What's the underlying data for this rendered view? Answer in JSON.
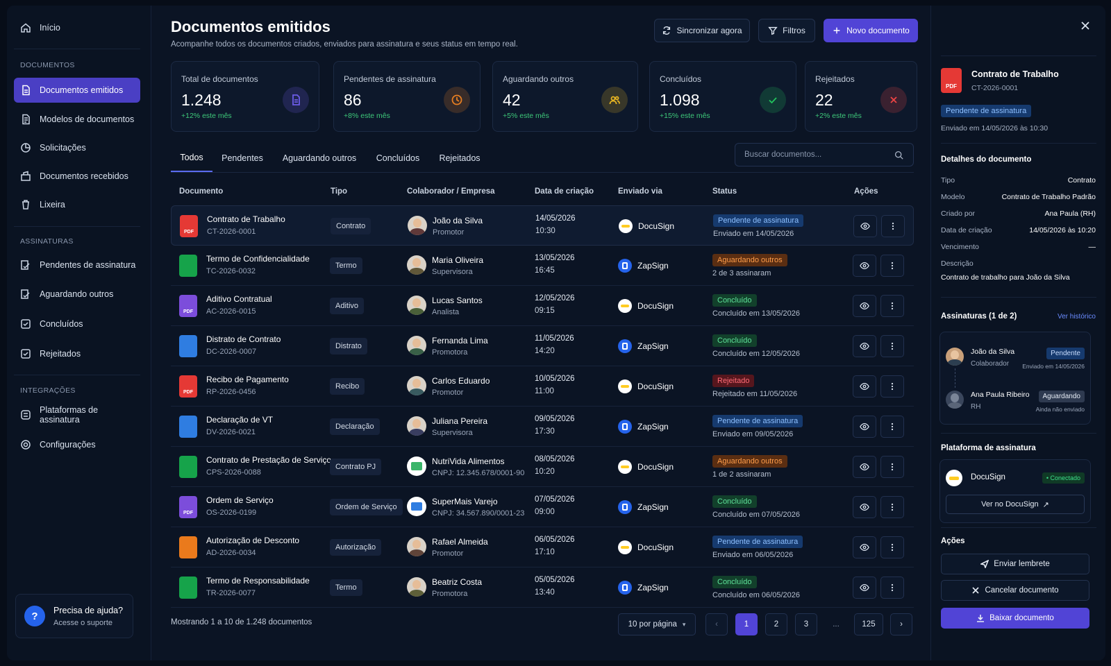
{
  "sidebar": {
    "home": "Início",
    "section_docs": "DOCUMENTOS",
    "docs_items": [
      "Documentos emitidos",
      "Modelos de documentos",
      "Solicitações",
      "Documentos recebidos",
      "Lixeira"
    ],
    "section_sign": "ASSINATURAS",
    "sign_items": [
      "Pendentes de assinatura",
      "Aguardando outros",
      "Concluídos",
      "Rejeitados"
    ],
    "section_int": "INTEGRAÇÕES",
    "int_items": [
      "Plataformas de assinatura",
      "Configurações"
    ],
    "help_title": "Precisa de ajuda?",
    "help_sub": "Acesse o suporte"
  },
  "header": {
    "title": "Documentos emitidos",
    "subtitle": "Acompanhe todos os documentos criados, enviados para assinatura e seus status em tempo real.",
    "sync": "Sincronizar agora",
    "filters": "Filtros",
    "new_doc": "Novo documento"
  },
  "stats": [
    {
      "label": "Total de documentos",
      "value": "1.248",
      "change": "+12% este mês",
      "color": "#6c5ce7",
      "icon": "document-icon"
    },
    {
      "label": "Pendentes de assinatura",
      "value": "86",
      "change": "+8% este mês",
      "color": "#e67e22",
      "icon": "clock-icon"
    },
    {
      "label": "Aguardando outros",
      "value": "42",
      "change": "+5% este mês",
      "color": "#e6b422",
      "icon": "users-icon"
    },
    {
      "label": "Concluídos",
      "value": "1.098",
      "change": "+15% este mês",
      "color": "#22c55e",
      "icon": "check-icon"
    },
    {
      "label": "Rejeitados",
      "value": "22",
      "change": "+2% este mês",
      "color": "#ef4444",
      "icon": "x-icon"
    }
  ],
  "tabs": [
    "Todos",
    "Pendentes",
    "Aguardando outros",
    "Concluídos",
    "Rejeitados"
  ],
  "search": {
    "placeholder": "Buscar documentos..."
  },
  "columns": [
    "Documento",
    "Tipo",
    "Colaborador / Empresa",
    "Data de criação",
    "Enviado via",
    "Status",
    "Ações"
  ],
  "rows": [
    {
      "name": "Contrato de Trabalho",
      "code": "CT-2026-0001",
      "type": "Contrato",
      "person": "João da Silva",
      "role": "Promotor",
      "date": "14/05/2026",
      "time": "10:30",
      "platform": "DocuSign",
      "status": "Pendente de assinatura",
      "status_kind": "pend",
      "status_sub": "Enviado em 14/05/2026",
      "file": "pdf"
    },
    {
      "name": "Termo de Confidencialidade",
      "code": "TC-2026-0032",
      "type": "Termo",
      "person": "Maria Oliveira",
      "role": "Supervisora",
      "date": "13/05/2026",
      "time": "16:45",
      "platform": "ZapSign",
      "status": "Aguardando outros",
      "status_kind": "wait",
      "status_sub": "2 de 3 assinaram",
      "file": "sheet"
    },
    {
      "name": "Aditivo Contratual",
      "code": "AC-2026-0015",
      "type": "Aditivo",
      "person": "Lucas Santos",
      "role": "Analista",
      "date": "12/05/2026",
      "time": "09:15",
      "platform": "DocuSign",
      "status": "Concluído",
      "status_kind": "done",
      "status_sub": "Concluído em 13/05/2026",
      "file": "pdf-purple"
    },
    {
      "name": "Distrato de Contrato",
      "code": "DC-2026-0007",
      "type": "Distrato",
      "person": "Fernanda Lima",
      "role": "Promotora",
      "date": "11/05/2026",
      "time": "14:20",
      "platform": "ZapSign",
      "status": "Concluído",
      "status_kind": "done",
      "status_sub": "Concluído em 12/05/2026",
      "file": "doc"
    },
    {
      "name": "Recibo de Pagamento",
      "code": "RP-2026-0456",
      "type": "Recibo",
      "person": "Carlos Eduardo",
      "role": "Promotor",
      "date": "10/05/2026",
      "time": "11:00",
      "platform": "DocuSign",
      "status": "Rejeitado",
      "status_kind": "rej",
      "status_sub": "Rejeitado em 11/05/2026",
      "file": "pdf"
    },
    {
      "name": "Declaração de VT",
      "code": "DV-2026-0021",
      "type": "Declaração",
      "person": "Juliana Pereira",
      "role": "Supervisora",
      "date": "09/05/2026",
      "time": "17:30",
      "platform": "ZapSign",
      "status": "Pendente de assinatura",
      "status_kind": "pend",
      "status_sub": "Enviado em 09/05/2026",
      "file": "doc"
    },
    {
      "name": "Contrato de Prestação de Serviço",
      "code": "CPS-2026-0088",
      "type": "Contrato PJ",
      "person": "NutriVida Alimentos",
      "role": "CNPJ: 12.345.678/0001-90",
      "date": "08/05/2026",
      "time": "10:20",
      "platform": "DocuSign",
      "status": "Aguardando outros",
      "status_kind": "wait",
      "status_sub": "1 de 2 assinaram",
      "file": "sheet"
    },
    {
      "name": "Ordem de Serviço",
      "code": "OS-2026-0199",
      "type": "Ordem de Serviço",
      "person": "SuperMais Varejo",
      "role": "CNPJ: 34.567.890/0001-23",
      "date": "07/05/2026",
      "time": "09:00",
      "platform": "ZapSign",
      "status": "Concluído",
      "status_kind": "done",
      "status_sub": "Concluído em 07/05/2026",
      "file": "pdf-purple"
    },
    {
      "name": "Autorização de Desconto",
      "code": "AD-2026-0034",
      "type": "Autorização",
      "person": "Rafael Almeida",
      "role": "Promotor",
      "date": "06/05/2026",
      "time": "17:10",
      "platform": "DocuSign",
      "status": "Pendente de assinatura",
      "status_kind": "pend",
      "status_sub": "Enviado em 06/05/2026",
      "file": "orange"
    },
    {
      "name": "Termo de Responsabilidade",
      "code": "TR-2026-0077",
      "type": "Termo",
      "person": "Beatriz Costa",
      "role": "Promotora",
      "date": "05/05/2026",
      "time": "13:40",
      "platform": "ZapSign",
      "status": "Concluído",
      "status_kind": "done",
      "status_sub": "Concluído em 06/05/2026",
      "file": "sheet"
    }
  ],
  "footer": {
    "showing": "Mostrando 1 a 10 de 1.248 documentos",
    "per_page": "10 por página",
    "pages": [
      "1",
      "2",
      "3",
      "...",
      "125"
    ]
  },
  "panel": {
    "doc_title": "Contrato de Trabalho",
    "doc_code": "CT-2026-0001",
    "status": "Pendente de assinatura",
    "sent": "Enviado em 14/05/2026 às 10:30",
    "details_title": "Detalhes do documento",
    "details": [
      {
        "k": "Tipo",
        "v": "Contrato"
      },
      {
        "k": "Modelo",
        "v": "Contrato de Trabalho Padrão"
      },
      {
        "k": "Criado por",
        "v": "Ana Paula (RH)"
      },
      {
        "k": "Data de criação",
        "v": "14/05/2026 às 10:20"
      },
      {
        "k": "Vencimento",
        "v": "—"
      }
    ],
    "desc_label": "Descrição",
    "desc": "Contrato de trabalho para João da Silva",
    "sign_title": "Assinaturas (1 de 2)",
    "history": "Ver histórico",
    "signers": [
      {
        "name": "João da Silva",
        "role": "Colaborador",
        "status": "Pendente",
        "note": "Enviado em 14/05/2026"
      },
      {
        "name": "Ana Paula Ribeiro",
        "role": "RH",
        "status": "Aguardando",
        "note": "Ainda não enviado"
      }
    ],
    "platform_title": "Plataforma de assinatura",
    "platform": "DocuSign",
    "connected": "• Conectado",
    "open_platform": "Ver no DocuSign",
    "actions_title": "Ações",
    "remind": "Enviar lembrete",
    "cancel": "Cancelar documento",
    "download": "Baixar documento"
  }
}
